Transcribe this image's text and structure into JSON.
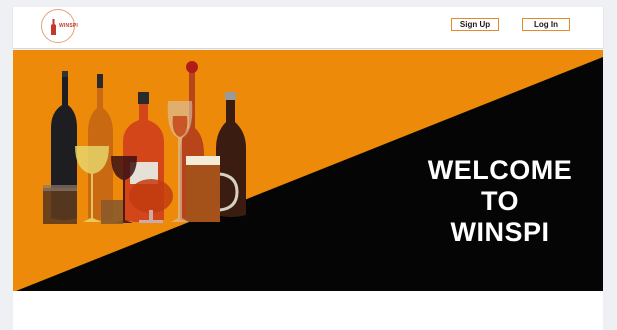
{
  "navbar": {
    "logo_text": "WINSPI",
    "signup_label": "Sign Up",
    "login_label": "Log In"
  },
  "hero": {
    "welcome_lines": [
      "WELCOME",
      "TO",
      "WINSPI"
    ],
    "colors": {
      "orange": "#ee8a09",
      "black": "#050505"
    }
  }
}
